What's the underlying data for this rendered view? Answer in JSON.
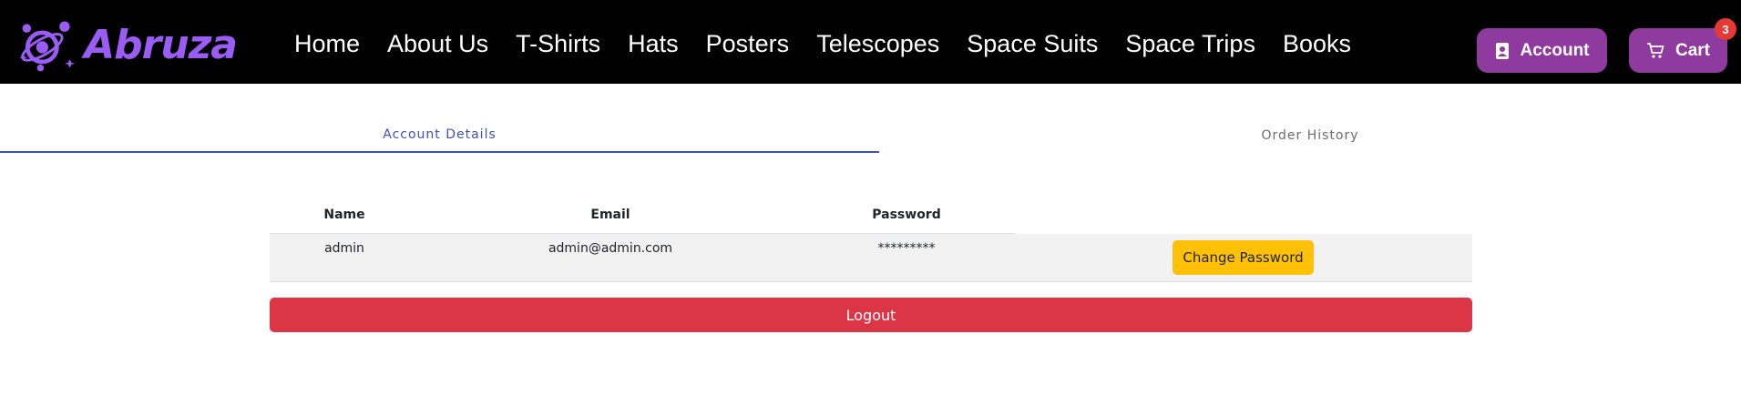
{
  "header": {
    "brand": "Abruza",
    "nav": [
      "Home",
      "About Us",
      "T-Shirts",
      "Hats",
      "Posters",
      "Telescopes",
      "Space Suits",
      "Space Trips",
      "Books"
    ],
    "account_label": "Account",
    "cart_label": "Cart",
    "cart_count": "3",
    "colors": {
      "background": "#000000",
      "brand": "#9b5cf6",
      "button": "#8e3a9e",
      "badge": "#e53935"
    },
    "icons": {
      "logo": "planet-logo-icon",
      "account": "user-badge-icon",
      "cart": "shopping-cart-icon"
    }
  },
  "tabs": {
    "account_details": "Account Details",
    "order_history": "Order History",
    "active": "Account Details",
    "accent": "#3f51b5"
  },
  "table": {
    "headers": {
      "name": "Name",
      "email": "Email",
      "password": "Password"
    },
    "row": {
      "name": "admin",
      "email": "admin@admin.com",
      "password": "*********"
    },
    "change_password_label": "Change Password"
  },
  "logout_label": "Logout",
  "colors": {
    "change_password": "#ffc107",
    "logout": "#dc3545",
    "row_bg": "#f2f2f2"
  }
}
